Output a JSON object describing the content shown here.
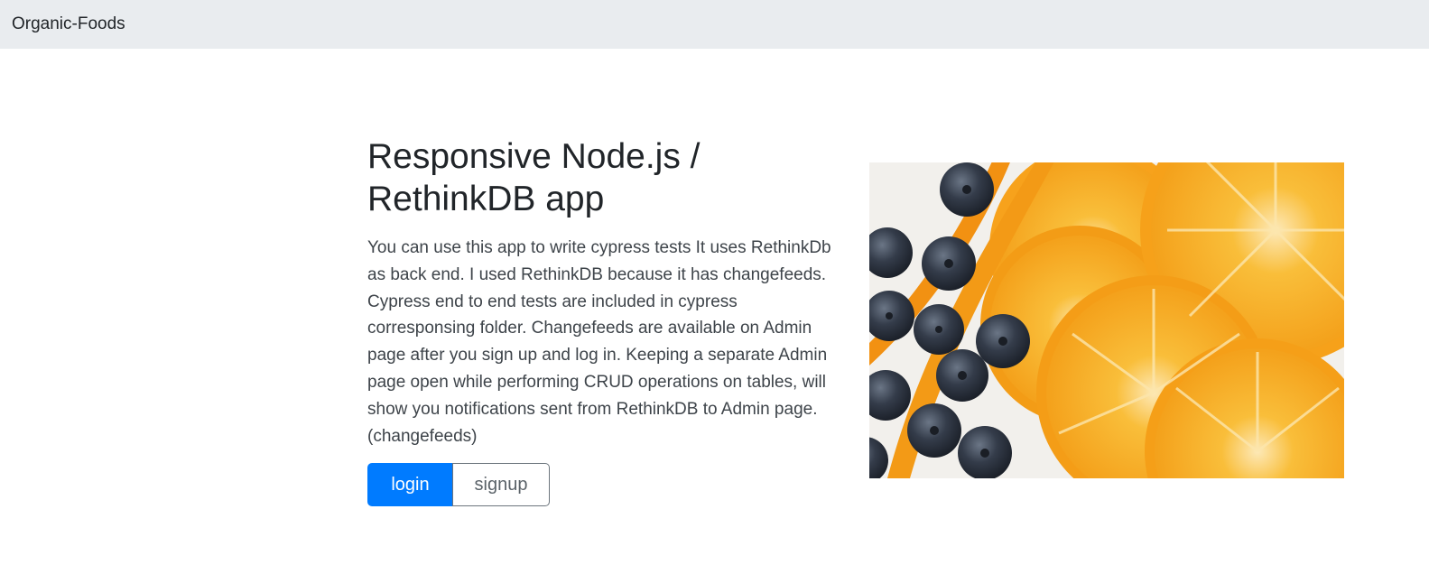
{
  "navbar": {
    "brand": "Organic-Foods"
  },
  "hero": {
    "title": "Responsive Node.js / RethinkDB app",
    "lead": "You can use this app to write cypress tests It uses RethinkDb as back end. I used RethinkDB because it has changefeeds. Cypress end to end tests are included in cypress corresponsing folder. Changefeeds are available on Admin page after you sign up and log in. Keeping a separate Admin page open while performing CRUD operations on tables, will show you notifications sent from RethinkDB to Admin page. (changefeeds)",
    "login_label": "login",
    "signup_label": "signup"
  },
  "colors": {
    "navbar_bg": "#e9ecef",
    "primary": "#007bff",
    "outline": "#6c757d",
    "orange": "#f7a823",
    "blueberry": "#2c3340"
  }
}
